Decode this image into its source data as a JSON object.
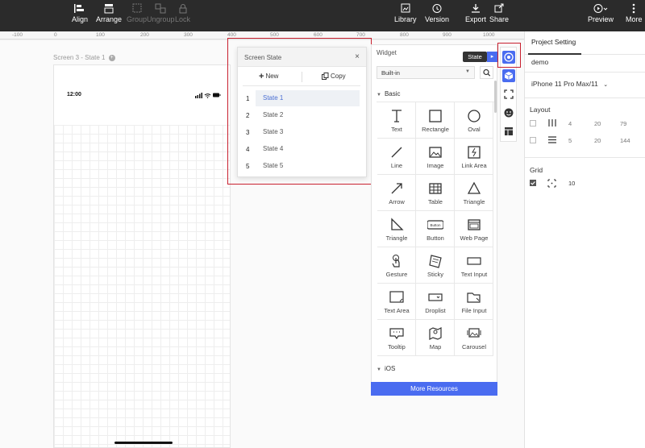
{
  "toolbar": {
    "align": "Align",
    "arrange": "Arrange",
    "group": "Group",
    "ungroup": "Ungroup",
    "lock": "Lock",
    "library": "Library",
    "version": "Version",
    "export": "Export",
    "share": "Share",
    "preview": "Preview",
    "more": "More"
  },
  "ruler": {
    "ticks": [
      "-100",
      "0",
      "100",
      "200",
      "300",
      "400",
      "500",
      "600",
      "700",
      "800",
      "900",
      "1000"
    ]
  },
  "canvas": {
    "screen_label": "Screen 3 - State 1",
    "phone_time": "12:00"
  },
  "screen_state": {
    "title": "Screen State",
    "close": "×",
    "new_label": "New",
    "copy_label": "Copy",
    "states": [
      {
        "num": "1",
        "name": "State 1"
      },
      {
        "num": "2",
        "name": "State 2"
      },
      {
        "num": "3",
        "name": "State 3"
      },
      {
        "num": "4",
        "name": "State 4"
      },
      {
        "num": "5",
        "name": "State 5"
      }
    ]
  },
  "widget": {
    "title": "Widget",
    "library_select": "Built-in",
    "section_basic": "Basic",
    "section_ios": "iOS",
    "items": [
      "Text",
      "Rectangle",
      "Oval",
      "Line",
      "Image",
      "Link Area",
      "Arrow",
      "Table",
      "Triangle",
      "Triangle",
      "Button",
      "Web Page",
      "Gesture",
      "Sticky",
      "Text Input",
      "Text Area",
      "Droplist",
      "File Input",
      "Tooltip",
      "Map",
      "Carousel"
    ],
    "button_icon_text": "Button",
    "more_resources": "More Resources"
  },
  "tooltip": {
    "state": "State"
  },
  "right_panel": {
    "tab": "Project Setting",
    "project_name": "demo",
    "device": "iPhone 11 Pro Max/11",
    "layout_title": "Layout",
    "layout_rows": [
      {
        "a": "4",
        "b": "20",
        "c": "79"
      },
      {
        "a": "5",
        "b": "20",
        "c": "144"
      }
    ],
    "grid_title": "Grid",
    "grid_value": "10"
  },
  "colors": {
    "accent": "#4a6cf0",
    "highlight": "#c8202f",
    "topbar": "#2b2b2b"
  }
}
